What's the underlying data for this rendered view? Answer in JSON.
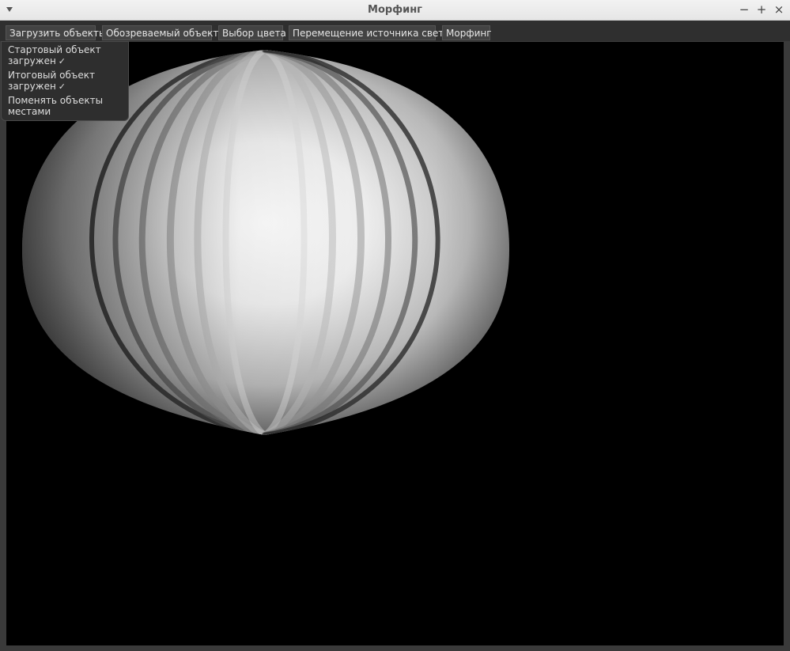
{
  "window": {
    "title": "Морфинг"
  },
  "toolbar": {
    "items": [
      {
        "label": "Загрузить объекты"
      },
      {
        "label": "Обозреваемый объект"
      },
      {
        "label": "Выбор цвета"
      },
      {
        "label": "Перемещение источника света"
      },
      {
        "label": "Морфинг"
      }
    ]
  },
  "dropdown": {
    "items": [
      {
        "line1": "Стартовый объект",
        "line2": "загружен",
        "check": "✓"
      },
      {
        "line1": "Итоговый объект",
        "line2": "загружен",
        "check": "✓"
      },
      {
        "line1": "Поменять объекты",
        "line2": "местами",
        "check": ""
      }
    ]
  },
  "viewport": {
    "background": "#000000",
    "object_color": "#ffffff"
  }
}
